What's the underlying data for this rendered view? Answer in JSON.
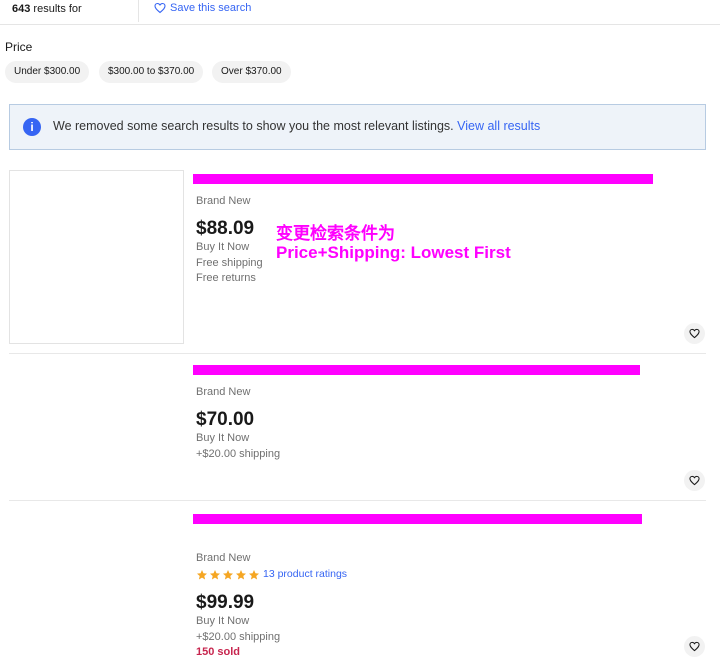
{
  "results_bar": {
    "count": "643",
    "count_suffix": " results for",
    "save_search_label": "Save this search"
  },
  "price_filter": {
    "title": "Price",
    "options": [
      "Under $300.00",
      "$300.00 to $370.00",
      "Over $370.00"
    ]
  },
  "banner": {
    "text": "We removed some search results to show you the most relevant listings.",
    "link": "View all results"
  },
  "listings": [
    {
      "condition": "Brand New",
      "price": "$88.09",
      "buy_format": "Buy It Now",
      "shipping": "Free shipping",
      "returns": "Free returns"
    },
    {
      "condition": "Brand New",
      "price": "$70.00",
      "buy_format": "Buy It Now",
      "shipping": "+$20.00 shipping"
    },
    {
      "condition": "Brand New",
      "rating_stars": 5,
      "ratings": "13 product ratings",
      "price": "$99.99",
      "buy_format": "Buy It Now",
      "shipping": "+$20.00 shipping",
      "sold": "150 sold"
    }
  ],
  "annotation": {
    "line1": "变更检索条件为",
    "line2": "Price+Shipping: Lowest First"
  },
  "colors": {
    "accent": "#3665f3",
    "annotation": "#ff00ff",
    "sold": "#c7254e",
    "star": "#f5a623"
  }
}
